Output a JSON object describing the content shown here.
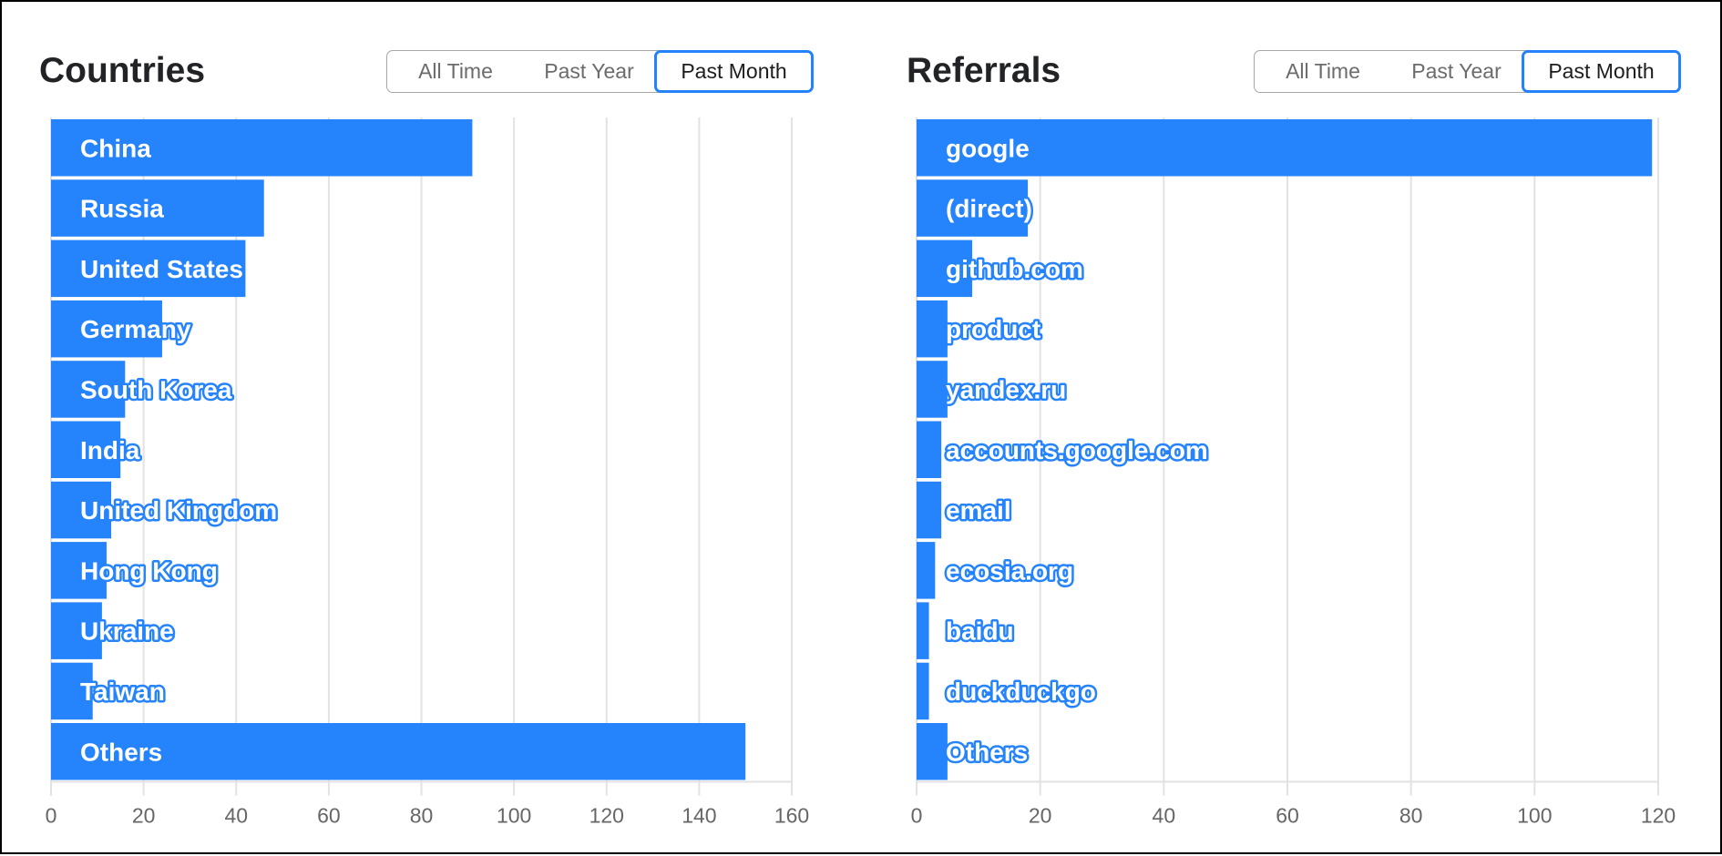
{
  "colors": {
    "bar": "#2583fb",
    "active_border": "#2483fb",
    "grid": "#e2e2e2",
    "title": "#222326",
    "tick_label": "#666666"
  },
  "panels": [
    {
      "id": "countries",
      "title": "Countries",
      "range_options": [
        "All Time",
        "Past Year",
        "Past Month"
      ],
      "selected_range": "Past Month"
    },
    {
      "id": "referrals",
      "title": "Referrals",
      "range_options": [
        "All Time",
        "Past Year",
        "Past Month"
      ],
      "selected_range": "Past Month"
    }
  ],
  "chart_data": [
    {
      "type": "bar",
      "orientation": "horizontal",
      "title": "Countries",
      "categories": [
        "China",
        "Russia",
        "United States",
        "Germany",
        "South Korea",
        "India",
        "United Kingdom",
        "Hong Kong",
        "Ukraine",
        "Taiwan",
        "Others"
      ],
      "values": [
        91,
        46,
        42,
        24,
        16,
        15,
        13,
        12,
        11,
        9,
        150
      ],
      "xlabel": "",
      "ylabel": "",
      "xlim": [
        0,
        160
      ],
      "xticks": [
        0,
        20,
        40,
        60,
        80,
        100,
        120,
        140,
        160
      ],
      "grid": true,
      "legend": "none"
    },
    {
      "type": "bar",
      "orientation": "horizontal",
      "title": "Referrals",
      "categories": [
        "google",
        "(direct)",
        "github.com",
        "product",
        "yandex.ru",
        "accounts.google.com",
        "email",
        "ecosia.org",
        "baidu",
        "duckduckgo",
        "Others"
      ],
      "values": [
        119,
        18,
        9,
        5,
        5,
        4,
        4,
        3,
        2,
        2,
        5
      ],
      "xlabel": "",
      "ylabel": "",
      "xlim": [
        0,
        120
      ],
      "xticks": [
        0,
        20,
        40,
        60,
        80,
        100,
        120
      ],
      "grid": true,
      "legend": "none"
    }
  ]
}
